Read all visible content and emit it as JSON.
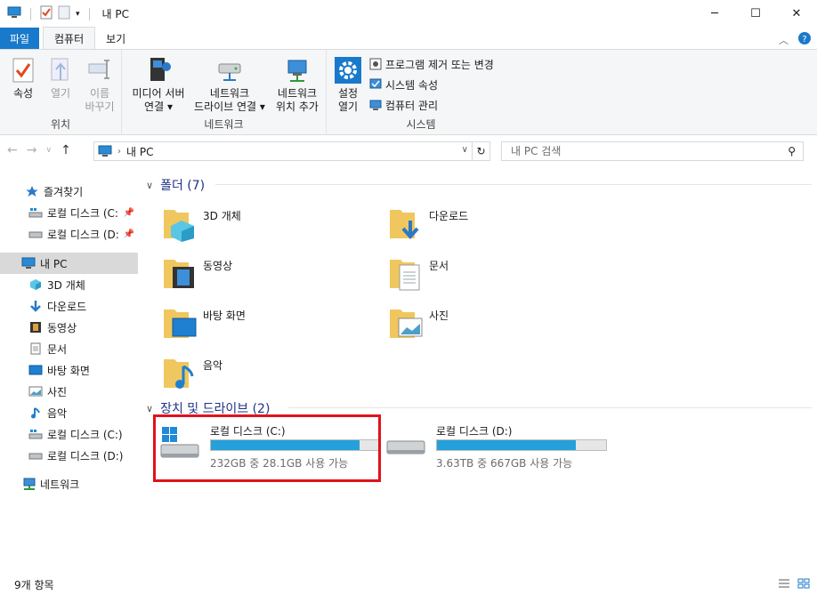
{
  "window": {
    "title": "내 PC"
  },
  "ribbon_tabs": {
    "file": "파일",
    "computer": "컴퓨터",
    "view": "보기"
  },
  "ribbon": {
    "location_group": {
      "label": "위치",
      "properties": "속성",
      "open": "열기",
      "rename_line1": "이름",
      "rename_line2": "바꾸기"
    },
    "network_group": {
      "label": "네트워크",
      "media_server_line1": "미디어 서버",
      "media_server_line2": "연결",
      "map_drive_line1": "네트워크",
      "map_drive_line2": "드라이브 연결",
      "add_location_line1": "네트워크",
      "add_location_line2": "위치 추가"
    },
    "system_group": {
      "label": "시스템",
      "open_settings_line1": "설정",
      "open_settings_line2": "열기",
      "uninstall": "프로그램 제거 또는 변경",
      "system_properties": "시스템 속성",
      "manage": "컴퓨터 관리"
    }
  },
  "address": {
    "path": "내 PC",
    "search_placeholder": "내 PC 검색"
  },
  "sidebar": {
    "items": [
      {
        "label": "즐겨찾기",
        "icon": "star-icon"
      },
      {
        "label": "로컬 디스크 (C:",
        "icon": "drive-c-icon"
      },
      {
        "label": "로컬 디스크 (D:",
        "icon": "drive-icon"
      },
      {
        "label": "내 PC",
        "icon": "pc-icon"
      },
      {
        "label": "3D 개체",
        "icon": "3d-icon"
      },
      {
        "label": "다운로드",
        "icon": "download-icon"
      },
      {
        "label": "동영상",
        "icon": "video-icon"
      },
      {
        "label": "문서",
        "icon": "document-icon"
      },
      {
        "label": "바탕 화면",
        "icon": "desktop-icon"
      },
      {
        "label": "사진",
        "icon": "picture-icon"
      },
      {
        "label": "음악",
        "icon": "music-icon"
      },
      {
        "label": "로컬 디스크 (C:)",
        "icon": "drive-c-icon"
      },
      {
        "label": "로컬 디스크 (D:)",
        "icon": "drive-icon"
      },
      {
        "label": "네트워크",
        "icon": "network-icon"
      }
    ]
  },
  "content": {
    "folders_header": "폴더 (7)",
    "folders": [
      {
        "label": "3D 개체",
        "icon": "3d-folder-icon"
      },
      {
        "label": "다운로드",
        "icon": "download-folder-icon"
      },
      {
        "label": "동영상",
        "icon": "video-folder-icon"
      },
      {
        "label": "문서",
        "icon": "document-folder-icon"
      },
      {
        "label": "바탕 화면",
        "icon": "desktop-folder-icon"
      },
      {
        "label": "사진",
        "icon": "picture-folder-icon"
      },
      {
        "label": "음악",
        "icon": "music-folder-icon"
      }
    ],
    "drives_header": "장치 및 드라이브 (2)",
    "drives": [
      {
        "label": "로컬 디스크 (C:)",
        "free_text": "232GB 중 28.1GB 사용 가능",
        "used_fraction": 0.88
      },
      {
        "label": "로컬 디스크 (D:)",
        "free_text": "3.63TB 중 667GB 사용 가능",
        "used_fraction": 0.82
      }
    ]
  },
  "status": {
    "count": "9개 항목"
  },
  "colors": {
    "accent": "#1979ca",
    "bar_fill": "#26a0da",
    "highlight": "#e0121b",
    "folder": "#f0c75e"
  }
}
